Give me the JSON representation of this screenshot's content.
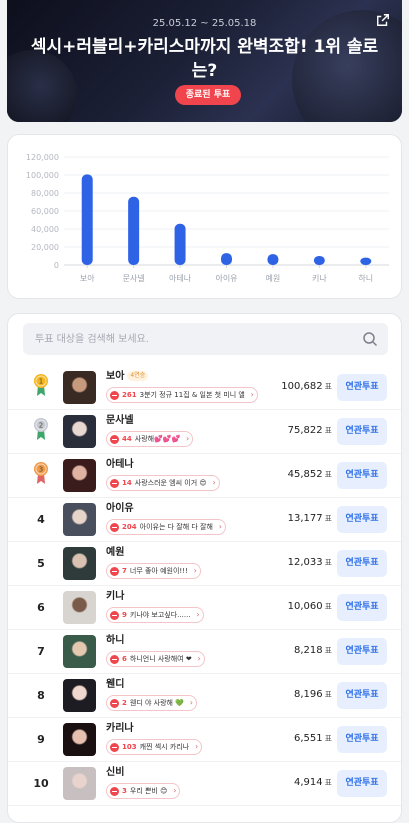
{
  "header": {
    "date_range": "25.05.12 ~ 25.05.18",
    "title": "섹시+러블리+카리스마까지 완벽조합! 1위 솔로는?",
    "status_badge": "종료된 투표",
    "share_icon": "external-link-icon"
  },
  "chart_data": {
    "type": "bar",
    "categories": [
      "보아",
      "문사넬",
      "아테나",
      "아이유",
      "예원",
      "키나",
      "하니"
    ],
    "values": [
      100682,
      75822,
      45852,
      13177,
      12033,
      10060,
      8218
    ],
    "ylim": [
      0,
      120000
    ],
    "yticks": [
      "0",
      "20,000",
      "40,000",
      "60,000",
      "80,000",
      "100,000",
      "120,000"
    ],
    "grid": true,
    "bar_color": "#2f63e6"
  },
  "search": {
    "placeholder": "투표 대상을 검색해 보세요.",
    "icon": "search-icon"
  },
  "vote_unit": "표",
  "vote_button_label": "연관투표",
  "ranking": [
    {
      "rank": "1",
      "medal": "gold",
      "name": "보아",
      "tag": "4연승",
      "comment_count": "261",
      "comment": "3분기 정규 11집 & 일본 첫 미니 앨",
      "votes": "100,682"
    },
    {
      "rank": "2",
      "medal": "silver",
      "name": "문사넬",
      "tag": "",
      "comment_count": "44",
      "comment": "사랑해💕💕💕",
      "votes": "75,822"
    },
    {
      "rank": "3",
      "medal": "bronze",
      "name": "아테나",
      "tag": "",
      "comment_count": "14",
      "comment": "사랑스러운 엠씨 이거 😍",
      "votes": "45,852"
    },
    {
      "rank": "4",
      "medal": "",
      "name": "아이유",
      "tag": "",
      "comment_count": "204",
      "comment": "아이유는 다 잘해 다 잘해",
      "votes": "13,177"
    },
    {
      "rank": "5",
      "medal": "",
      "name": "예원",
      "tag": "",
      "comment_count": "7",
      "comment": "너무 좋아 예원이!!!",
      "votes": "12,033"
    },
    {
      "rank": "6",
      "medal": "",
      "name": "키나",
      "tag": "",
      "comment_count": "9",
      "comment": "키나야 보고싶다......",
      "votes": "10,060"
    },
    {
      "rank": "7",
      "medal": "",
      "name": "하니",
      "tag": "",
      "comment_count": "6",
      "comment": "하니언니 사랑해여 ❤",
      "votes": "8,218"
    },
    {
      "rank": "8",
      "medal": "",
      "name": "웬디",
      "tag": "",
      "comment_count": "2",
      "comment": "웬디 야 사랑해 💚",
      "votes": "8,196"
    },
    {
      "rank": "9",
      "medal": "",
      "name": "카리나",
      "tag": "",
      "comment_count": "103",
      "comment": "캐찐 섹시 카리나",
      "votes": "6,551"
    },
    {
      "rank": "10",
      "medal": "",
      "name": "신비",
      "tag": "",
      "comment_count": "3",
      "comment": "우리 쁜비 😊",
      "votes": "4,914"
    }
  ]
}
